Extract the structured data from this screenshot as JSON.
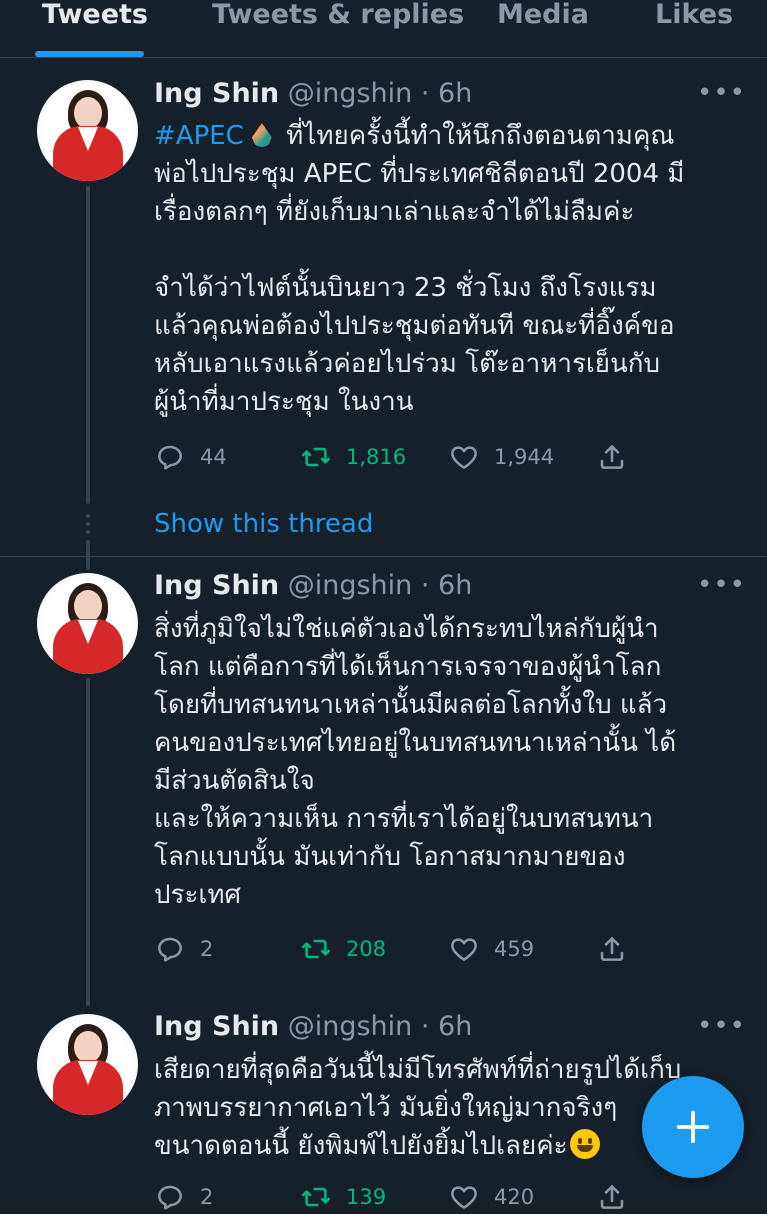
{
  "tabs": [
    "Tweets",
    "Tweets & replies",
    "Media",
    "Likes"
  ],
  "show_thread": "Show this thread",
  "tweets": [
    {
      "name": "Ing Shin",
      "handle": "@ingshin",
      "time": "6h",
      "hashtag": "#APEC",
      "lines": [
        "ที่ไทยครั้งนี้ทำให้นึกถึงตอนตามคุณ",
        "พ่อไปประชุม APEC ที่ประเทศชิลีตอนปี 2004 มี",
        "เรื่องตลกๆ ที่ยังเก็บมาเล่าและจำได้ไม่ลืมค่ะ",
        "",
        "จำได้ว่าไฟต์นั้นบินยาว 23 ชั่วโมง ถึงโรงแรม",
        "แล้วคุณพ่อต้องไปประชุมต่อทันที ขณะที่อิ๊งค์ขอ",
        "หลับเอาแรงแล้วค่อยไปร่วม โต๊ะอาหารเย็นกับ",
        "ผู้นำที่มาประชุม ในงาน"
      ],
      "replies": "44",
      "retweets": "1,816",
      "likes": "1,944"
    },
    {
      "name": "Ing Shin",
      "handle": "@ingshin",
      "time": "6h",
      "lines": [
        "สิ่งที่ภูมิใจไม่ใช่แค่ตัวเองได้กระทบไหล่กับผู้นำ",
        "โลก แต่คือการที่ได้เห็นการเจรจาของผู้นำโลก",
        "โดยที่บทสนทนาเหล่านั้นมีผลต่อโลกทั้งใบ แล้ว",
        "คนของประเทศไทยอยู่ในบทสนทนาเหล่านั้น ได้",
        "มีส่วนตัดสินใจ",
        "และให้ความเห็น การที่เราได้อยู่ในบทสนทนา",
        "โลกแบบนั้น มันเท่ากับ โอกาสมากมายของ",
        "ประเทศ"
      ],
      "replies": "2",
      "retweets": "208",
      "likes": "459"
    },
    {
      "name": "Ing Shin",
      "handle": "@ingshin",
      "time": "6h",
      "lines": [
        "เสียดายที่สุดคือวันนี้ไม่มีโทรศัพท์ที่ถ่ายรูปได้เก็บ",
        "ภาพบรรยากาศเอาไว้ มันยิ่งใหญ่มากจริงๆ",
        "ขนาดตอนนี้ ยังพิมพ์ไปยังยิ้มไปเลยค่ะ"
      ],
      "replies": "2",
      "retweets": "139",
      "likes": "420"
    }
  ],
  "colors": {
    "background": "#15202b",
    "accent": "#1d9bf0",
    "retweet": "#00ba7c",
    "muted": "#8b98a5",
    "divider": "#38444d"
  },
  "icons": [
    "reply-icon",
    "retweet-icon",
    "like-icon",
    "share-icon",
    "more-icon",
    "compose-plus-icon"
  ]
}
